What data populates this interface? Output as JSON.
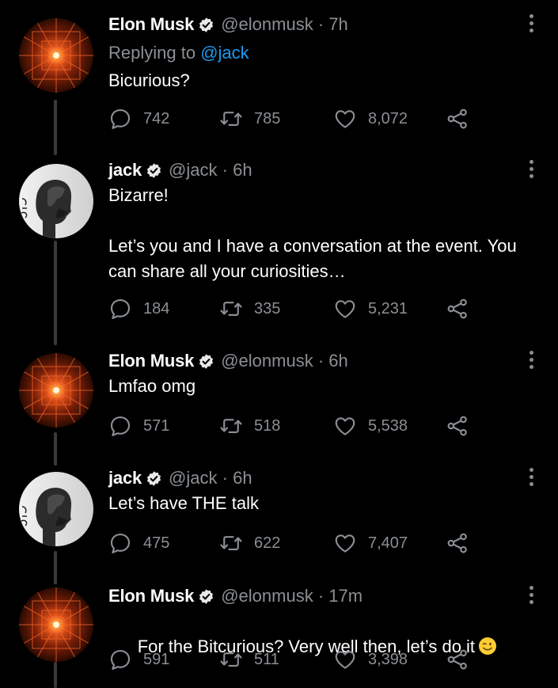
{
  "tweets": [
    {
      "name": "Elon Musk",
      "handle": "@elonmusk",
      "separator": "·",
      "time": "7h",
      "replying_prefix": "Replying to",
      "replying_to": "@jack",
      "text": "Bicurious?",
      "replies": "742",
      "retweets": "785",
      "likes": "8,072",
      "avatar": "elon-avatar"
    },
    {
      "name": "jack",
      "handle": "@jack",
      "separator": "·",
      "time": "6h",
      "text": "Bizarre!\n\nLet’s you and I have a conversation at the event. You can share all your curiosities…",
      "replies": "184",
      "retweets": "335",
      "likes": "5,231",
      "avatar": "jack-avatar"
    },
    {
      "name": "Elon Musk",
      "handle": "@elonmusk",
      "separator": "·",
      "time": "6h",
      "text": "Lmfao omg",
      "replies": "571",
      "retweets": "518",
      "likes": "5,538",
      "avatar": "elon-avatar"
    },
    {
      "name": "jack",
      "handle": "@jack",
      "separator": "·",
      "time": "6h",
      "text": "Let’s have THE talk",
      "replies": "475",
      "retweets": "622",
      "likes": "7,407",
      "avatar": "jack-avatar"
    },
    {
      "name": "Elon Musk",
      "handle": "@elonmusk",
      "separator": "·",
      "time": "17m",
      "text": "For the Bitcurious? Very well then, let’s do it",
      "emoji": "winking-face-emoji",
      "replies": "591",
      "retweets": "511",
      "likes": "3,398",
      "avatar": "elon-avatar"
    }
  ],
  "icons": {
    "reply": "reply-icon",
    "retweet": "retweet-icon",
    "like": "heart-icon",
    "share": "share-icon",
    "verified": "verified-badge-icon",
    "more": "more-options-icon"
  },
  "colors": {
    "background": "#000000",
    "text_primary": "#ffffff",
    "text_secondary": "#8b8f94",
    "link": "#1d9bf0",
    "thread_line": "#3a3a3a"
  }
}
